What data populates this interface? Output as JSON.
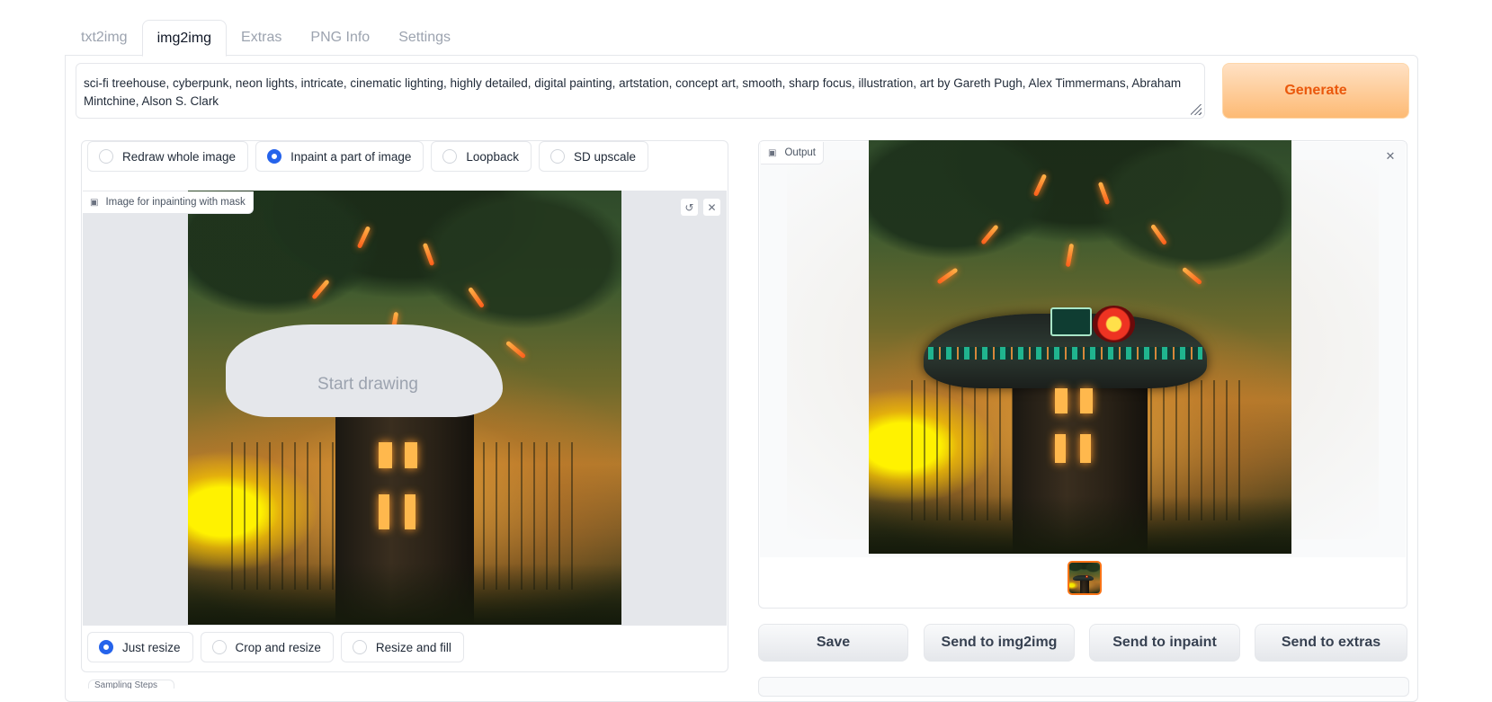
{
  "tabs": [
    {
      "label": "txt2img"
    },
    {
      "label": "img2img"
    },
    {
      "label": "Extras"
    },
    {
      "label": "PNG Info"
    },
    {
      "label": "Settings"
    }
  ],
  "active_tab": "img2img",
  "prompt": {
    "value": "sci-fi treehouse, cyberpunk, neon lights, intricate, cinematic lighting, highly detailed, digital painting, artstation, concept art, smooth, sharp focus, illustration, art by Gareth Pugh, Alex Timmermans, Abraham Mintchine, Alson S. Clark"
  },
  "generate_label": "Generate",
  "mode_options": [
    {
      "label": "Redraw whole image",
      "checked": false
    },
    {
      "label": "Inpaint a part of image",
      "checked": true
    },
    {
      "label": "Loopback",
      "checked": false
    },
    {
      "label": "SD upscale",
      "checked": false
    }
  ],
  "input_image": {
    "label": "Image for inpainting with mask",
    "placeholder": "Start drawing",
    "undo_icon": "undo-icon",
    "clear_icon": "close-icon"
  },
  "resize_options": [
    {
      "label": "Just resize",
      "checked": true
    },
    {
      "label": "Crop and resize",
      "checked": false
    },
    {
      "label": "Resize and fill",
      "checked": false
    }
  ],
  "sampling_label": "Sampling Steps",
  "output": {
    "label": "Output",
    "close_icon": "close-icon"
  },
  "actions": {
    "save": "Save",
    "send_img2img": "Send to img2img",
    "send_inpaint": "Send to inpaint",
    "send_extras": "Send to extras"
  },
  "colors": {
    "accent": "#2563eb",
    "generate_text": "#ea580c",
    "generate_bg": "#fdba74"
  }
}
